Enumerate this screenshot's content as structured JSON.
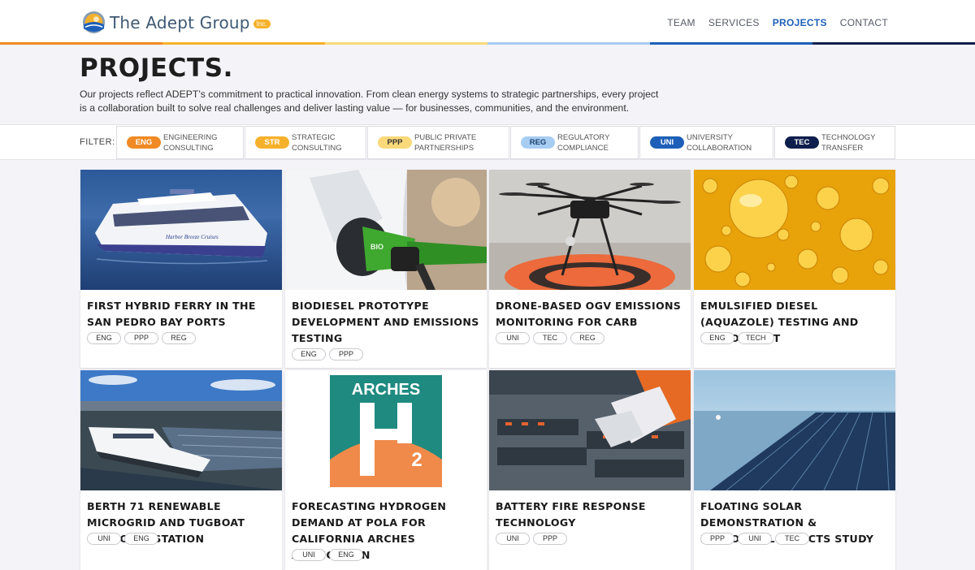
{
  "brand": {
    "name": "The Adept Group",
    "badge": "Inc."
  },
  "nav": [
    {
      "label": "TEAM",
      "active": false
    },
    {
      "label": "SERVICES",
      "active": false
    },
    {
      "label": "PROJECTS",
      "active": true
    },
    {
      "label": "CONTACT",
      "active": false
    }
  ],
  "page": {
    "title": "PROJECTS.",
    "description": "Our projects reflect ADEPT’s commitment to practical innovation. From clean energy systems to strategic partnerships, every project is a collaboration built to solve real challenges and deliver lasting value — for businesses, communities, and the environment."
  },
  "filter": {
    "label": "FILTER:",
    "items": [
      {
        "code": "ENG",
        "name": "Engineering Consulting",
        "color": "#f08a24",
        "text_color": "#ffffff"
      },
      {
        "code": "STR",
        "name": "Strategic Consulting",
        "color": "#f6b12c",
        "text_color": "#ffffff"
      },
      {
        "code": "PPP",
        "name": "Public Private Partnerships",
        "color": "#f9d97a",
        "text_color": "#333333"
      },
      {
        "code": "REG",
        "name": "Regulatory Compliance",
        "color": "#a7cdf3",
        "text_color": "#1d3f6e"
      },
      {
        "code": "UNI",
        "name": "University Collaboration",
        "color": "#1d5fb8",
        "text_color": "#ffffff"
      },
      {
        "code": "TEC",
        "name": "Technology Transfer",
        "color": "#0e1f4d",
        "text_color": "#ffffff"
      }
    ]
  },
  "projects": [
    {
      "title": "First Hybrid Ferry in the San Pedro Bay Ports",
      "tags": [
        "ENG",
        "PPP",
        "REG"
      ],
      "image": "ferry",
      "image_text": "Harbor Breeze Cruises"
    },
    {
      "title": "Biodiesel Prototype Development and Emissions Testing",
      "tags": [
        "ENG",
        "PPP"
      ],
      "image": "fuel-nozzle",
      "image_text": "BIO"
    },
    {
      "title": "Drone-Based OGV Emissions Monitoring for CARB",
      "tags": [
        "UNI",
        "TEC",
        "REG"
      ],
      "image": "drone"
    },
    {
      "title": "Emulsified Diesel (Aquazole) Testing and Deployment",
      "tags": [
        "ENG",
        "TECH"
      ],
      "image": "oil-bubbles"
    },
    {
      "title": "Berth 71 Renewable Microgrid and Tugboat Charging Station",
      "tags": [
        "UNI",
        "ENG"
      ],
      "image": "port-ship"
    },
    {
      "title": "Forecasting Hydrogen Demand at POLA for California ARCHES Application",
      "tags": [
        "UNI",
        "ENG"
      ],
      "image": "arches-logo",
      "image_text": "ARCHES"
    },
    {
      "title": "Battery Fire Response Technology",
      "tags": [
        "UNI",
        "PPP"
      ],
      "image": "battery"
    },
    {
      "title": "Floating Solar Demonstration & Ecological Impacts Study",
      "tags": [
        "PPP",
        "UNI",
        "TEC"
      ],
      "image": "floating-solar"
    }
  ],
  "colors": {
    "stripe": [
      "#f08a24",
      "#f6b12c",
      "#f9d97a",
      "#a7cdf3",
      "#1d5fb8",
      "#0e1f4d"
    ]
  }
}
